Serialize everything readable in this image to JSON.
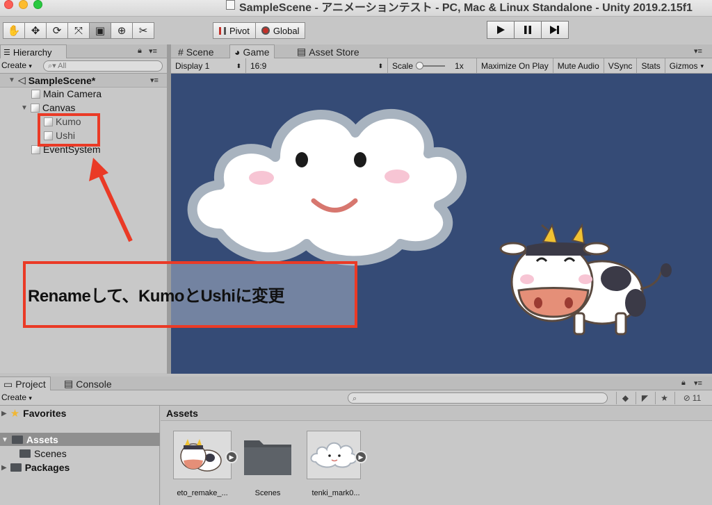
{
  "window": {
    "title": "SampleScene - アニメーションテスト - PC, Mac & Linux Standalone - Unity 2019.2.15f1"
  },
  "toolbar": {
    "tools": [
      "hand-tool",
      "move-tool",
      "rotate-tool",
      "scale-tool",
      "rect-tool",
      "transform-tool",
      "custom-tool"
    ],
    "pivot_label": "Pivot",
    "global_label": "Global"
  },
  "hierarchy": {
    "tab_label": "Hierarchy",
    "create_label": "Create",
    "search_placeholder": "All",
    "scene_name": "SampleScene*",
    "items": [
      "Main Camera",
      "Canvas",
      "Kumo",
      "Ushi",
      "EventSystem"
    ]
  },
  "game": {
    "tabs": [
      "Scene",
      "Game",
      "Asset Store"
    ],
    "display": "Display 1",
    "aspect": "16:9",
    "scale_label": "Scale",
    "scale_value": "1x",
    "maximize": "Maximize On Play",
    "mute": "Mute Audio",
    "vsync": "VSync",
    "stats": "Stats",
    "gizmos": "Gizmos"
  },
  "annotation": {
    "text": "Renameして、KumoとUshiに変更"
  },
  "project": {
    "tabs": [
      "Project",
      "Console"
    ],
    "create_label": "Create",
    "visible_count": "11",
    "tree": {
      "favorites": "Favorites",
      "assets": "Assets",
      "scenes": "Scenes",
      "packages": "Packages"
    },
    "assets_header": "Assets",
    "assets": [
      {
        "label": "eto_remake_..."
      },
      {
        "label": "Scenes"
      },
      {
        "label": "tenki_mark0..."
      }
    ]
  },
  "colors": {
    "game_bg": "#354b76",
    "highlight_red": "#ea3a26",
    "selection": "#8f8f8f"
  }
}
